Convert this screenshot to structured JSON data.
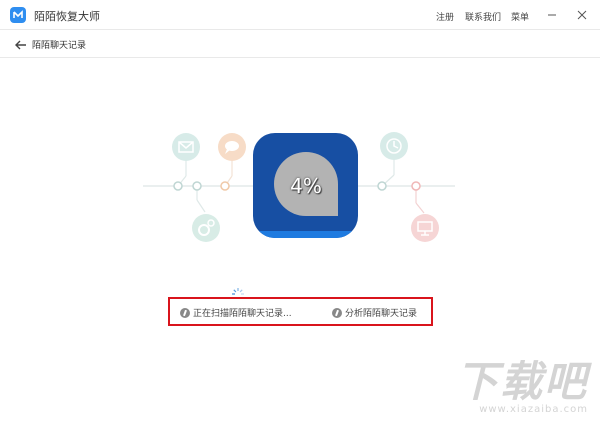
{
  "window": {
    "title": "陌陌恢复大师",
    "menu": {
      "register": "注册",
      "contact": "联系我们",
      "menu": "菜单"
    }
  },
  "subheader": {
    "title": "陌陌聊天记录"
  },
  "progress": {
    "percent_text": "4%",
    "value": 4
  },
  "steps": [
    {
      "label": "正在扫描陌陌聊天记录...",
      "icon": "scan-icon"
    },
    {
      "label": "分析陌陌聊天记录",
      "icon": "analyze-icon"
    }
  ],
  "colors": {
    "accent": "#174fa3",
    "highlight": "#d9141c"
  },
  "watermark": {
    "main": "下载吧",
    "url": "www.xiazaiba.com"
  }
}
